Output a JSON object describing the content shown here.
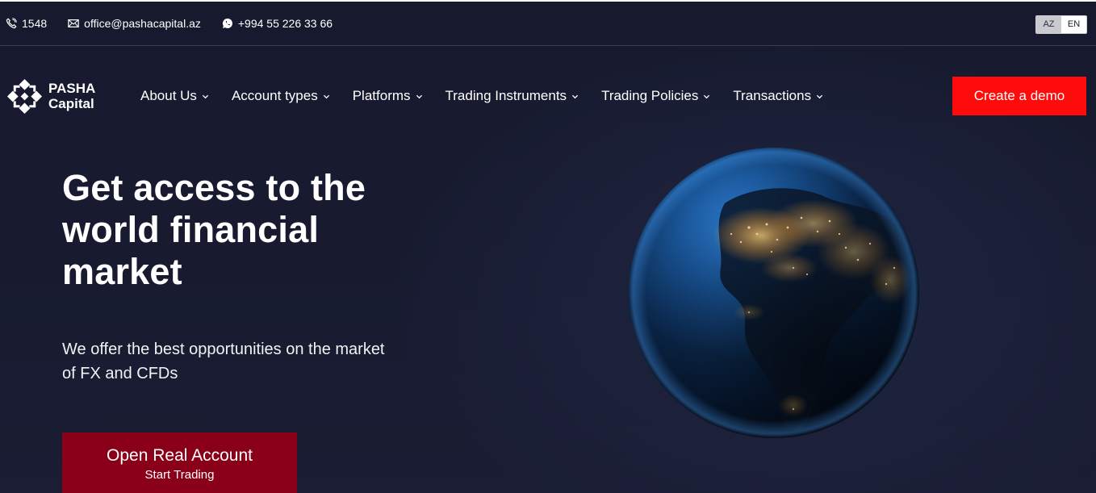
{
  "topbar": {
    "phone_short": "1548",
    "email": "office@pashacapital.az",
    "whatsapp": "+994 55 226 33 66",
    "lang_az": "AZ",
    "lang_en": "EN"
  },
  "logo": {
    "line1": "PASHA",
    "line2": "Capital"
  },
  "nav": {
    "items": [
      {
        "label": "About Us"
      },
      {
        "label": "Account types"
      },
      {
        "label": "Platforms"
      },
      {
        "label": "Trading Instruments"
      },
      {
        "label": "Trading Policies"
      },
      {
        "label": "Transactions"
      }
    ],
    "demo_label": "Create a demo"
  },
  "hero": {
    "title_line1": "Get access to the",
    "title_line2": "world financial",
    "title_line3": "market",
    "subtitle_line1": "We offer the best opportunities on the market",
    "subtitle_line2": "of FX and CFDs",
    "cta_main": "Open Real Account",
    "cta_sub": "Start Trading"
  },
  "colors": {
    "background": "#16192e",
    "demo_button": "#ff0b0b",
    "cta_button": "#8a0019",
    "lang_active": "#c9cad0"
  },
  "icons": {
    "phone": "phone-icon",
    "email": "envelope-icon",
    "whatsapp": "whatsapp-icon",
    "chevron": "chevron-down-icon",
    "logo": "pasha-logo-icon"
  }
}
